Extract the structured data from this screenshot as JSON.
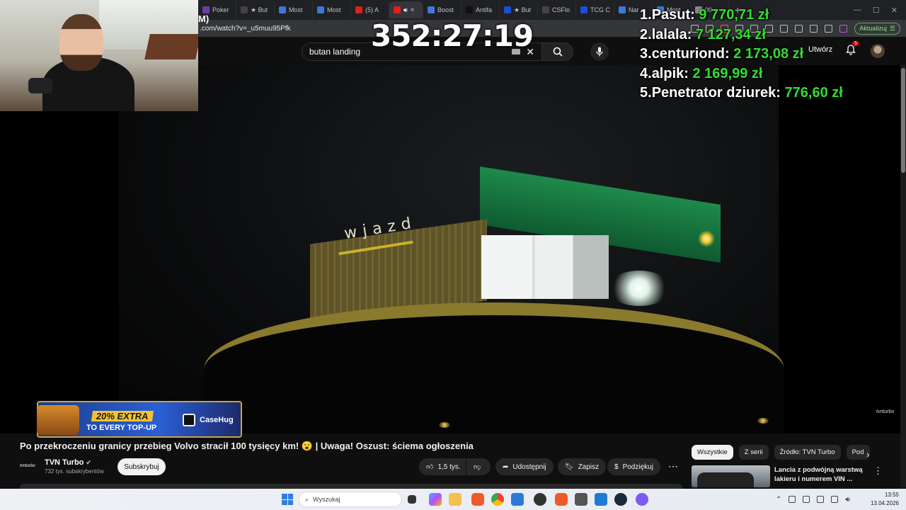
{
  "browser": {
    "tabs": [
      {
        "label": "Poker",
        "color": "#6b3fa0"
      },
      {
        "label": "★ But",
        "color": "#444"
      },
      {
        "label": "Most",
        "color": "#3d79d8"
      },
      {
        "label": "Most",
        "color": "#3d79d8"
      },
      {
        "label": "(5) A",
        "color": "#e01e1e"
      },
      {
        "label": "",
        "color": "#e01e1e",
        "active": true
      },
      {
        "label": "Boost",
        "color": "#3d79d8"
      },
      {
        "label": "Antifa",
        "color": "#111"
      },
      {
        "label": "★ But",
        "color": "#1d4ed8"
      },
      {
        "label": "CSFlo",
        "color": "#444"
      },
      {
        "label": "TCG C",
        "color": "#1d4ed8"
      },
      {
        "label": "Nar",
        "color": "#3d79d8"
      },
      {
        "label": "Most",
        "color": "#3d79d8"
      },
      {
        "label": "00",
        "color": "#888"
      }
    ],
    "url": ".com/watch?v=_u5muu95Pfk",
    "update_label": "Aktualizuj"
  },
  "youtube": {
    "search_value": "butan landing",
    "create_label": "Utwórz",
    "notification_count": "5",
    "video_title": "Po przekroczeniu granicy przebieg Volvo stracił 100 tysięcy km! 😮 | Uwaga! Oszust: ściema ogłoszenia",
    "channel_logo": "tvnturbo",
    "channel_name": "TVN Turbo",
    "subscriber_count": "732 tys. subskrybentów",
    "subscribe_label": "Subskrybuj",
    "like_count": "1,5 tys.",
    "share_label": "Udostępnij",
    "save_label": "Zapisz",
    "thanks_label": "Podziękuj",
    "chips": [
      "Wszystkie",
      "Z serii",
      "Źródło: TVN Turbo",
      "Pod"
    ],
    "recommended": {
      "title": "Lancia z podwójną warstwą lakieru i numerem VIN ..."
    },
    "watermark": "tvnturbo"
  },
  "video_scene": {
    "sign_text": "wjazd"
  },
  "overlay": {
    "timer": "352:27:19",
    "url_fragment": "M)",
    "leaderboard": [
      {
        "rank": "1.",
        "name": "Pasut:",
        "amount": "9 770,71 zł"
      },
      {
        "rank": "2.",
        "name": "lalala:",
        "amount": "7 127,34 zł"
      },
      {
        "rank": "3.",
        "name": "centuriond:",
        "amount": "2 173,08 zł"
      },
      {
        "rank": "4.",
        "name": "alpik:",
        "amount": "2 169,99 zł"
      },
      {
        "rank": "5.",
        "name": "Penetrator dziurek:",
        "amount": "776,60 zł"
      }
    ],
    "ad": {
      "headline": "20% EXTRA",
      "subline": "TO EVERY TOP-UP",
      "brand": "CaseHug"
    }
  },
  "taskbar": {
    "search_placeholder": "Wyszukaj",
    "time": "13:55",
    "date": "13.04.2026"
  },
  "colors": {
    "youtube_bg": "#0f0f0f",
    "leaderboard_amount": "#33dd33",
    "accent_red": "#cc0000"
  }
}
